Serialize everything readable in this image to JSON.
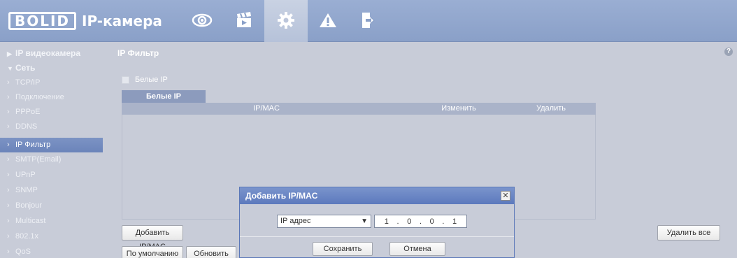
{
  "header": {
    "logo": "BOLID",
    "title": "IP-камера",
    "nav": [
      {
        "icon": "eye-icon"
      },
      {
        "icon": "clapperboard-icon"
      },
      {
        "icon": "gear-icon"
      },
      {
        "icon": "warning-icon"
      },
      {
        "icon": "exit-icon"
      }
    ],
    "active_nav": "gear-icon"
  },
  "sidebar": {
    "items": [
      {
        "label": "IP видеокамера",
        "type": "group",
        "expanded": false
      },
      {
        "label": "Сеть",
        "type": "group",
        "expanded": true
      },
      {
        "label": "TCP/IP",
        "type": "sub"
      },
      {
        "label": "Подключение",
        "type": "sub"
      },
      {
        "label": "PPPoE",
        "type": "sub"
      },
      {
        "label": "DDNS",
        "type": "sub"
      },
      {
        "label": "IP Фильтр",
        "type": "sub",
        "active": true
      },
      {
        "label": "SMTP(Email)",
        "type": "sub"
      },
      {
        "label": "UPnP",
        "type": "sub"
      },
      {
        "label": "SNMP",
        "type": "sub"
      },
      {
        "label": "Bonjour",
        "type": "sub"
      },
      {
        "label": "Multicast",
        "type": "sub"
      },
      {
        "label": "802.1x",
        "type": "sub"
      },
      {
        "label": "QoS",
        "type": "sub"
      }
    ]
  },
  "main": {
    "tab": "IP Фильтр",
    "help": "?",
    "checkbox_label": "Белые IP",
    "inner_tab": "Белые IP",
    "columns": [
      "IP/MAC",
      "Изменить",
      "Удалить"
    ],
    "rows": [],
    "add_button": "Добавить IP/MAC",
    "delete_all_button": "Удалить все",
    "default_button": "По умолчанию",
    "refresh_button": "Обновить"
  },
  "dialog": {
    "title": "Добавить IP/MAC",
    "close": "✕",
    "type_select": "IP адрес",
    "ip_octets": [
      "1",
      "0",
      "0",
      "1"
    ],
    "save_button": "Сохранить",
    "cancel_button": "Отмена"
  }
}
